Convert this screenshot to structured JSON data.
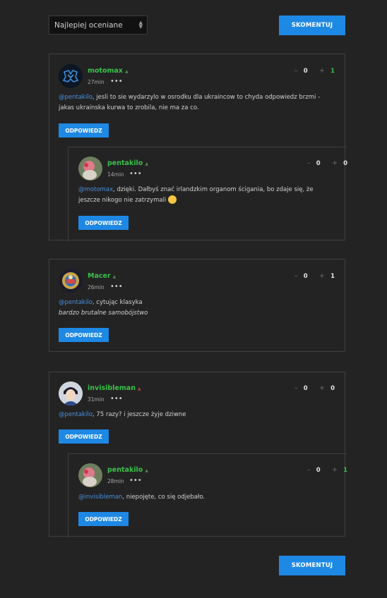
{
  "sort": {
    "selected": "Najlepiej oceniane"
  },
  "comment_button_label": "SKOMENTUJ",
  "reply_label": "ODPOWIEDZ",
  "vote_minus": "–",
  "vote_plus": "+",
  "more": "•••",
  "threads": [
    {
      "comment": {
        "author": "motomax",
        "time": "27min",
        "down": "0",
        "up": "1",
        "mention": "@pentakilo",
        "text": ", jesli to sie wydarzylo w osrodku dla ukraincow to chyda odpowiedz brzmi -",
        "text2": "jakas ukrainska kurwa to zrobila, nie ma za co."
      },
      "reply": {
        "author": "pentakilo",
        "time": "14min",
        "down": "0",
        "up": "0",
        "mention": "@motomax",
        "text": ", dzięki. Dałbyś znać irlandzkim organom ścigania, bo zdaje się, że",
        "text2": "jeszcze nikogo nie zatrzymali"
      }
    },
    {
      "comment": {
        "author": "Macer",
        "time": "26min",
        "down": "0",
        "up": "1",
        "mention": "@pentakilo",
        "text": ", cytując klasyka",
        "text2": "bardzo brutalne samobójstwo"
      }
    },
    {
      "comment": {
        "author": "invisibleman",
        "time": "31min",
        "down": "0",
        "up": "0",
        "mention": "@pentakilo",
        "text": ", 75 razy? i jeszcze żyje dziwne"
      },
      "reply": {
        "author": "pentakilo",
        "time": "28min",
        "down": "0",
        "up": "1",
        "mention": "@invisibleman",
        "text": ", niepojęte, co się odjebało."
      }
    }
  ],
  "colors": {
    "accent": "#1e88e5",
    "author": "#39c24a",
    "mention": "#4a90e2",
    "background": "#232323"
  }
}
